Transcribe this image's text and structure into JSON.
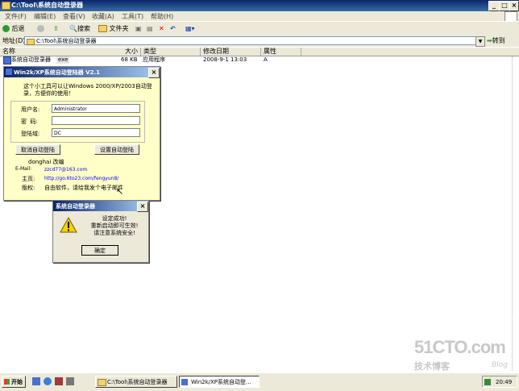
{
  "window": {
    "title": "C:\\Tool\\系统自动登录器"
  },
  "menu": [
    "文件(F)",
    "编辑(E)",
    "查看(V)",
    "收藏(A)",
    "工具(T)",
    "帮助(H)"
  ],
  "toolbar": {
    "back": "后退",
    "search": "搜索",
    "folders": "文件夹"
  },
  "address": {
    "label": "地址(D)",
    "value": "C:\\Tool\\系统自动登录器",
    "go": "转到"
  },
  "list": {
    "headers": [
      "名称",
      "大小",
      "类型",
      "修改日期",
      "属性"
    ],
    "rows": [
      {
        "name": "系统自动登录器",
        "ext": "exe",
        "size": "68 KB",
        "type": "应用程序",
        "date": "2008-9-1 13:03",
        "attr": "A"
      }
    ]
  },
  "dialog1": {
    "title": "Win2k/XP系统自动登陆器    V2.1",
    "desc": "这个小工具可以让Windows 2000/XP/2003自动登录，方便你的使用！",
    "user_label": "用户名:",
    "user_value": "Administrator",
    "pass_label": "密  码:",
    "pass_value": "",
    "domain_label": "登陆域:",
    "domain_value": "DC",
    "cancel_btn": "取消自动登陆",
    "set_btn": "设置自动登陆",
    "author": "donghai  改编",
    "email_label": "E-Mail:",
    "email": "zzcd77@163.com",
    "home_label": "主页:",
    "home": "http://go.6to23.com/fengyun8/",
    "copy_label": "版权:",
    "copy": "自由软件，请给我发个电子邮件"
  },
  "dialog2": {
    "title": "系统自动登录器",
    "line1": "设定成功!",
    "line2": "重新启动即可生效!",
    "line3": "请注意系统安全!",
    "ok": "确定"
  },
  "taskbar": {
    "start": "开始",
    "task1": "C:\\Tool\\系统自动登录器",
    "task2": "Win2k/XP系统自动登...",
    "clock": "20:49"
  },
  "watermark": {
    "brand": "51CTO.com",
    "sub": "技术博客",
    "blog": "Blog"
  },
  "colors": {
    "title_bar": "#0a246a",
    "dialog_bg": "#ffffc8",
    "link": "#0000ff",
    "chrome": "#ece9d8"
  }
}
